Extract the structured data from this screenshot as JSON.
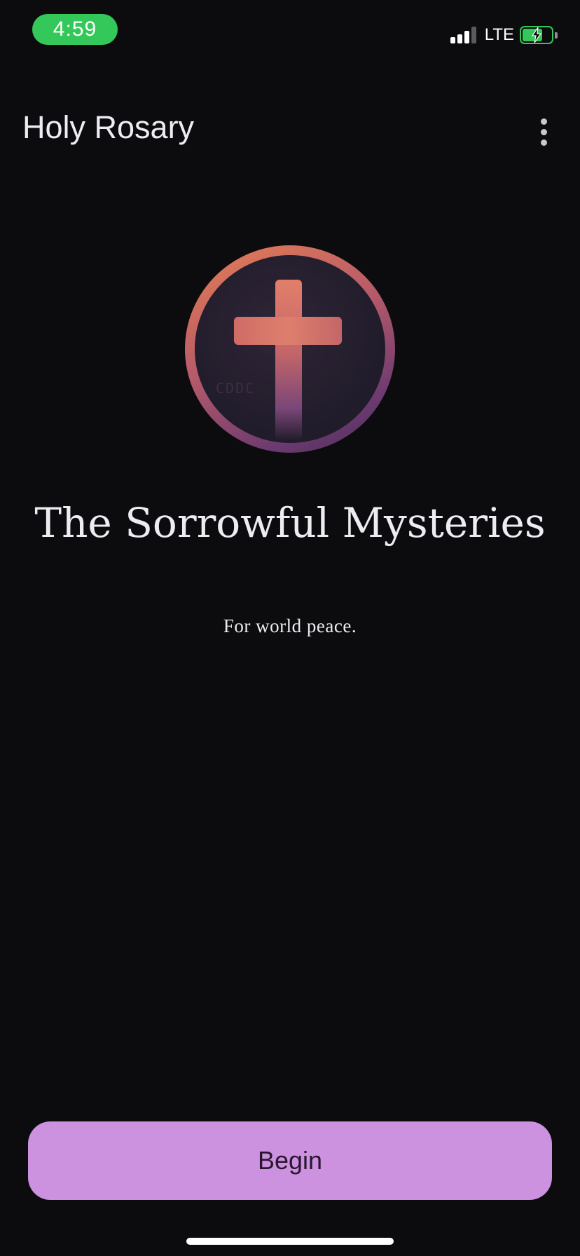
{
  "status_bar": {
    "time": "4:59",
    "network": "LTE",
    "icons": [
      "signal-icon",
      "battery-charging-icon"
    ],
    "time_pill_color": "#34c759"
  },
  "app_bar": {
    "title": "Holy Rosary",
    "menu_icon": "more-vertical-icon"
  },
  "main": {
    "emblem_icon": "cross-icon",
    "emblem_faint_text": "CDDC",
    "title": "The Sorrowful Mysteries",
    "intention": "For world peace."
  },
  "footer": {
    "begin_label": "Begin",
    "accent_color": "#cc91df"
  }
}
